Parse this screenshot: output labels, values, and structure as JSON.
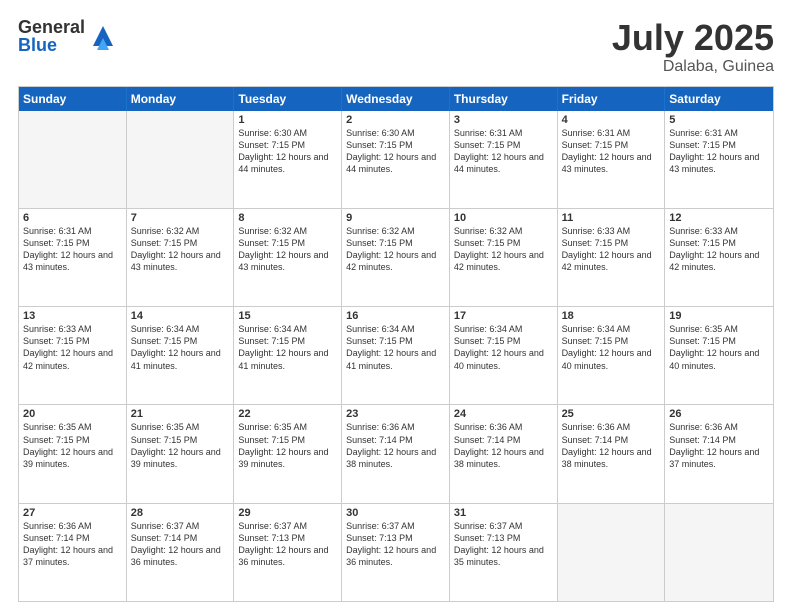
{
  "header": {
    "logo_general": "General",
    "logo_blue": "Blue",
    "title": "July 2025",
    "location": "Dalaba, Guinea"
  },
  "days_of_week": [
    "Sunday",
    "Monday",
    "Tuesday",
    "Wednesday",
    "Thursday",
    "Friday",
    "Saturday"
  ],
  "weeks": [
    [
      {
        "day": "",
        "info": "",
        "empty": true
      },
      {
        "day": "",
        "info": "",
        "empty": true
      },
      {
        "day": "1",
        "info": "Sunrise: 6:30 AM\nSunset: 7:15 PM\nDaylight: 12 hours and 44 minutes.",
        "empty": false
      },
      {
        "day": "2",
        "info": "Sunrise: 6:30 AM\nSunset: 7:15 PM\nDaylight: 12 hours and 44 minutes.",
        "empty": false
      },
      {
        "day": "3",
        "info": "Sunrise: 6:31 AM\nSunset: 7:15 PM\nDaylight: 12 hours and 44 minutes.",
        "empty": false
      },
      {
        "day": "4",
        "info": "Sunrise: 6:31 AM\nSunset: 7:15 PM\nDaylight: 12 hours and 43 minutes.",
        "empty": false
      },
      {
        "day": "5",
        "info": "Sunrise: 6:31 AM\nSunset: 7:15 PM\nDaylight: 12 hours and 43 minutes.",
        "empty": false
      }
    ],
    [
      {
        "day": "6",
        "info": "Sunrise: 6:31 AM\nSunset: 7:15 PM\nDaylight: 12 hours and 43 minutes.",
        "empty": false
      },
      {
        "day": "7",
        "info": "Sunrise: 6:32 AM\nSunset: 7:15 PM\nDaylight: 12 hours and 43 minutes.",
        "empty": false
      },
      {
        "day": "8",
        "info": "Sunrise: 6:32 AM\nSunset: 7:15 PM\nDaylight: 12 hours and 43 minutes.",
        "empty": false
      },
      {
        "day": "9",
        "info": "Sunrise: 6:32 AM\nSunset: 7:15 PM\nDaylight: 12 hours and 42 minutes.",
        "empty": false
      },
      {
        "day": "10",
        "info": "Sunrise: 6:32 AM\nSunset: 7:15 PM\nDaylight: 12 hours and 42 minutes.",
        "empty": false
      },
      {
        "day": "11",
        "info": "Sunrise: 6:33 AM\nSunset: 7:15 PM\nDaylight: 12 hours and 42 minutes.",
        "empty": false
      },
      {
        "day": "12",
        "info": "Sunrise: 6:33 AM\nSunset: 7:15 PM\nDaylight: 12 hours and 42 minutes.",
        "empty": false
      }
    ],
    [
      {
        "day": "13",
        "info": "Sunrise: 6:33 AM\nSunset: 7:15 PM\nDaylight: 12 hours and 42 minutes.",
        "empty": false
      },
      {
        "day": "14",
        "info": "Sunrise: 6:34 AM\nSunset: 7:15 PM\nDaylight: 12 hours and 41 minutes.",
        "empty": false
      },
      {
        "day": "15",
        "info": "Sunrise: 6:34 AM\nSunset: 7:15 PM\nDaylight: 12 hours and 41 minutes.",
        "empty": false
      },
      {
        "day": "16",
        "info": "Sunrise: 6:34 AM\nSunset: 7:15 PM\nDaylight: 12 hours and 41 minutes.",
        "empty": false
      },
      {
        "day": "17",
        "info": "Sunrise: 6:34 AM\nSunset: 7:15 PM\nDaylight: 12 hours and 40 minutes.",
        "empty": false
      },
      {
        "day": "18",
        "info": "Sunrise: 6:34 AM\nSunset: 7:15 PM\nDaylight: 12 hours and 40 minutes.",
        "empty": false
      },
      {
        "day": "19",
        "info": "Sunrise: 6:35 AM\nSunset: 7:15 PM\nDaylight: 12 hours and 40 minutes.",
        "empty": false
      }
    ],
    [
      {
        "day": "20",
        "info": "Sunrise: 6:35 AM\nSunset: 7:15 PM\nDaylight: 12 hours and 39 minutes.",
        "empty": false
      },
      {
        "day": "21",
        "info": "Sunrise: 6:35 AM\nSunset: 7:15 PM\nDaylight: 12 hours and 39 minutes.",
        "empty": false
      },
      {
        "day": "22",
        "info": "Sunrise: 6:35 AM\nSunset: 7:15 PM\nDaylight: 12 hours and 39 minutes.",
        "empty": false
      },
      {
        "day": "23",
        "info": "Sunrise: 6:36 AM\nSunset: 7:14 PM\nDaylight: 12 hours and 38 minutes.",
        "empty": false
      },
      {
        "day": "24",
        "info": "Sunrise: 6:36 AM\nSunset: 7:14 PM\nDaylight: 12 hours and 38 minutes.",
        "empty": false
      },
      {
        "day": "25",
        "info": "Sunrise: 6:36 AM\nSunset: 7:14 PM\nDaylight: 12 hours and 38 minutes.",
        "empty": false
      },
      {
        "day": "26",
        "info": "Sunrise: 6:36 AM\nSunset: 7:14 PM\nDaylight: 12 hours and 37 minutes.",
        "empty": false
      }
    ],
    [
      {
        "day": "27",
        "info": "Sunrise: 6:36 AM\nSunset: 7:14 PM\nDaylight: 12 hours and 37 minutes.",
        "empty": false
      },
      {
        "day": "28",
        "info": "Sunrise: 6:37 AM\nSunset: 7:14 PM\nDaylight: 12 hours and 36 minutes.",
        "empty": false
      },
      {
        "day": "29",
        "info": "Sunrise: 6:37 AM\nSunset: 7:13 PM\nDaylight: 12 hours and 36 minutes.",
        "empty": false
      },
      {
        "day": "30",
        "info": "Sunrise: 6:37 AM\nSunset: 7:13 PM\nDaylight: 12 hours and 36 minutes.",
        "empty": false
      },
      {
        "day": "31",
        "info": "Sunrise: 6:37 AM\nSunset: 7:13 PM\nDaylight: 12 hours and 35 minutes.",
        "empty": false
      },
      {
        "day": "",
        "info": "",
        "empty": true
      },
      {
        "day": "",
        "info": "",
        "empty": true
      }
    ]
  ]
}
